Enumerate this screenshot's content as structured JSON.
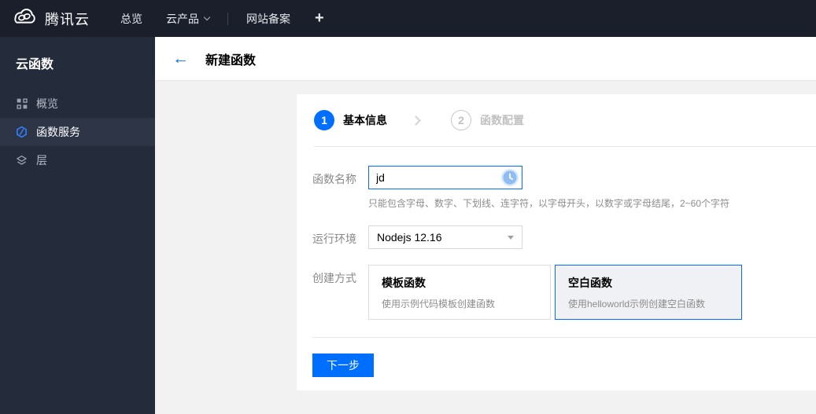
{
  "colors": {
    "accent": "#006eff",
    "chrome_dark": "#1a1f2b",
    "sidebar_dark": "#242b3a"
  },
  "topbar": {
    "brand": "腾讯云",
    "logo_icon": "cloud-icon",
    "nav": [
      {
        "label": "总览"
      },
      {
        "label": "云产品",
        "caret_icon": "chevron-down-icon"
      },
      {
        "label": "网站备案"
      }
    ],
    "plus": "+"
  },
  "sidebar": {
    "title": "云函数",
    "items": [
      {
        "label": "概览",
        "icon": "grid-icon",
        "selected": false
      },
      {
        "label": "函数服务",
        "icon": "scf-hexagon-icon",
        "selected": true
      },
      {
        "label": "层",
        "icon": "layers-icon",
        "selected": false
      }
    ]
  },
  "header": {
    "back": "←",
    "back_icon": "arrow-left-icon",
    "title": "新建函数"
  },
  "wizard": {
    "steps": [
      {
        "num": "1",
        "label": "基本信息",
        "active": true
      },
      {
        "num": "2",
        "label": "函数配置",
        "active": false
      }
    ],
    "separator_icon": "chevron-right-icon"
  },
  "form": {
    "name": {
      "label": "函数名称",
      "value": "jd",
      "trailing_icon": "clock-icon",
      "help": "只能包含字母、数字、下划线、连字符，以字母开头，以数字或字母结尾，2~60个字符"
    },
    "runtime": {
      "label": "运行环境",
      "value": "Nodejs 12.16",
      "caret_icon": "caret-down-icon"
    },
    "method": {
      "label": "创建方式",
      "options": [
        {
          "title": "模板函数",
          "desc": "使用示例代码模板创建函数",
          "selected": false
        },
        {
          "title": "空白函数",
          "desc": "使用helloworld示例创建空白函数",
          "selected": true
        }
      ]
    },
    "next_button": "下一步"
  }
}
